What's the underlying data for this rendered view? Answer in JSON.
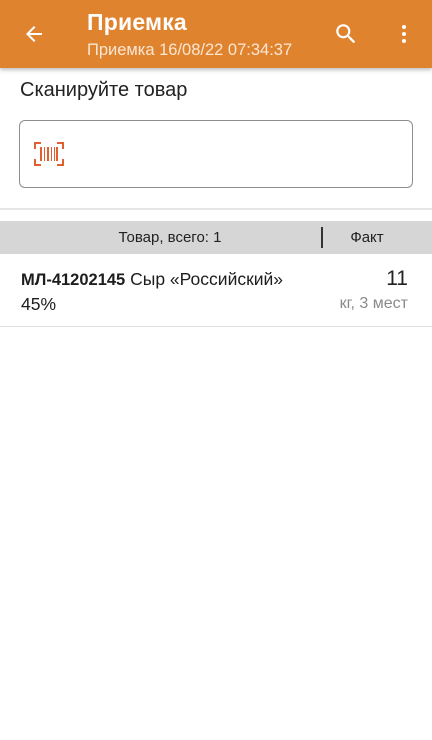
{
  "appbar": {
    "title": "Приемка",
    "subtitle": "Приемка 16/08/22 07:34:37",
    "back_icon": "arrow-left-icon",
    "search_icon": "search-icon",
    "more_icon": "more-vertical-icon",
    "color": "#e0832f"
  },
  "scan": {
    "prompt": "Сканируйте товар",
    "value": "",
    "icon": "barcode-icon",
    "icon_color": "#e0602f"
  },
  "table": {
    "header_goods": "Товар, всего: 1",
    "header_fact": "Факт",
    "rows": [
      {
        "code": "МЛ-41202145",
        "name_line1": "Сыр «Российский»",
        "name_line2": "45%",
        "qty": "11",
        "unit": "кг, 3 мест"
      }
    ]
  }
}
